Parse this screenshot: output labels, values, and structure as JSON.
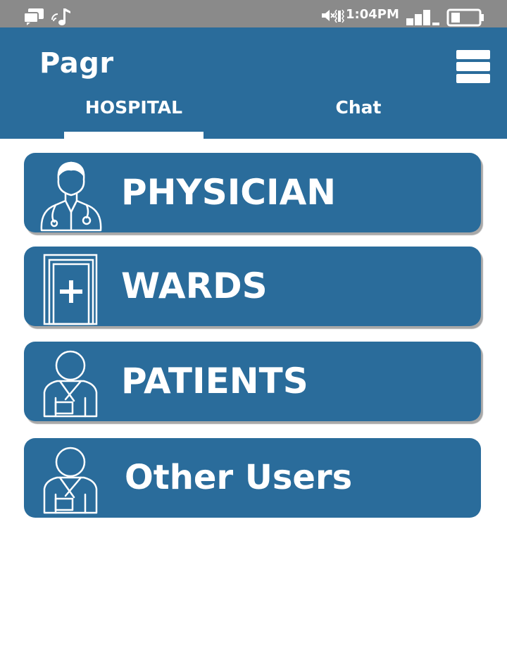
{
  "status_bar": {
    "time": "1:04PM",
    "icons": [
      "chat-notification-icon",
      "music-note-icon",
      "mute-icon",
      "vibrate-icon",
      "signal-icon",
      "battery-icon"
    ]
  },
  "app_bar": {
    "title": "Pagr",
    "menu_icon": "hamburger-menu-icon",
    "tabs": [
      {
        "label": "HOSPITAL",
        "selected": true
      },
      {
        "label": "Chat",
        "selected": false
      }
    ]
  },
  "menu": {
    "items": [
      {
        "label": "PHYSICIAN",
        "icon": "doctor-icon"
      },
      {
        "label": "WARDS",
        "icon": "ward-door-icon"
      },
      {
        "label": "PATIENTS",
        "icon": "patient-icon"
      },
      {
        "label": "Other Users",
        "icon": "user-icon"
      }
    ]
  },
  "colors": {
    "primary": "#2a6c9b",
    "status_bar": "#8a8a8a",
    "text_on_primary": "#ffffff"
  }
}
